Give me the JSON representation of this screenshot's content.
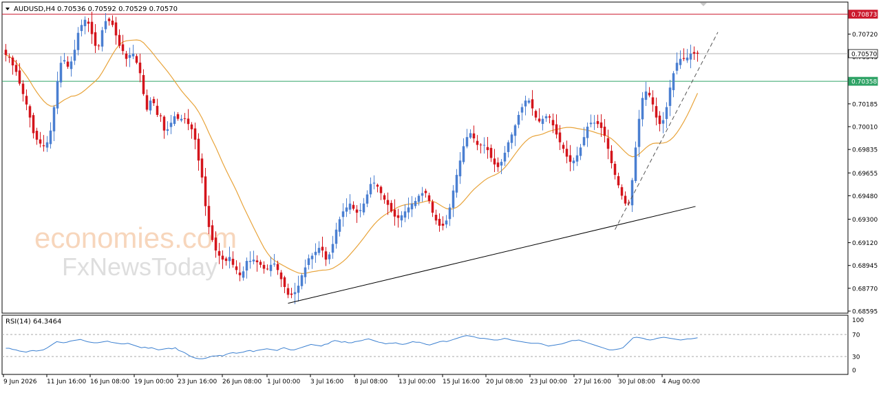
{
  "header": {
    "symbol_label": "AUDUSD,H4",
    "ohlc_label": "0.70536 0.70592 0.70529 0.70570"
  },
  "rsi_header": {
    "label": "RSI(14) 64.3464"
  },
  "watermark": {
    "line1": "economies.com",
    "line2": "FxNewsToday"
  },
  "colors": {
    "bull": "#4a7fd1",
    "bear": "#d4141b",
    "ma": "#e8a339",
    "rsi": "#3a7fd0",
    "resistance": "#cc1a2e",
    "support_level": "#2fa366",
    "current_line": "#b0b0b0",
    "trendline": "#000000",
    "grid": "#000000"
  },
  "chart_data": [
    {
      "type": "candlestick",
      "title": "AUDUSD,H4",
      "ylim": [
        0.68595,
        0.7095
      ],
      "y_ticks": [
        "0.70720",
        "0.70545",
        "0.70370",
        "0.70185",
        "0.70010",
        "0.69835",
        "0.69655",
        "0.69480",
        "0.69300",
        "0.69120",
        "0.68945",
        "0.68770",
        "0.68595"
      ],
      "x_tick_labels": [
        "9 Jun 2026",
        "11 Jun 16:00",
        "16 Jun 08:00",
        "19 Jun 00:00",
        "23 Jun 16:00",
        "26 Jun 08:00",
        "1 Jul 00:00",
        "3 Jul 16:00",
        "8 Jul 08:00",
        "13 Jul 00:00",
        "15 Jul 16:00",
        "20 Jul 08:00",
        "23 Jul 00:00",
        "27 Jul 16:00",
        "30 Jul 08:00",
        "4 Aug 00:00"
      ],
      "price_levels": [
        {
          "name": "resistance",
          "value": 0.70873,
          "label": "0.70873"
        },
        {
          "name": "current",
          "value": 0.7057,
          "label": "0.70570"
        },
        {
          "name": "support",
          "value": 0.70358,
          "label": "0.70358"
        }
      ],
      "closes": [
        0.7056,
        0.7054,
        0.7048,
        0.7043,
        0.7034,
        0.7026,
        0.7018,
        0.7008,
        0.6996,
        0.6991,
        0.6988,
        0.6986,
        0.6989,
        0.6998,
        0.7016,
        0.7036,
        0.705,
        0.7052,
        0.7047,
        0.7051,
        0.706,
        0.7073,
        0.7079,
        0.7083,
        0.708,
        0.7072,
        0.7063,
        0.7063,
        0.7075,
        0.7082,
        0.7082,
        0.7079,
        0.7071,
        0.7063,
        0.7059,
        0.7053,
        0.7056,
        0.7057,
        0.705,
        0.7042,
        0.7026,
        0.7014,
        0.7021,
        0.7019,
        0.701,
        0.7009,
        0.6998,
        0.6999,
        0.7004,
        0.7009,
        0.7007,
        0.7007,
        0.7007,
        0.7003,
        0.6999,
        0.6991,
        0.6975,
        0.6962,
        0.694,
        0.6924,
        0.6914,
        0.6906,
        0.6902,
        0.6899,
        0.6898,
        0.6901,
        0.6895,
        0.6891,
        0.6887,
        0.689,
        0.6898,
        0.6898,
        0.6899,
        0.6897,
        0.6895,
        0.6892,
        0.6892,
        0.6895,
        0.6896,
        0.6891,
        0.6884,
        0.6878,
        0.6872,
        0.6872,
        0.6874,
        0.6879,
        0.6887,
        0.6893,
        0.69,
        0.6902,
        0.6905,
        0.6908,
        0.6906,
        0.6899,
        0.6903,
        0.6911,
        0.6922,
        0.693,
        0.6936,
        0.6939,
        0.6942,
        0.6938,
        0.6935,
        0.6937,
        0.6942,
        0.6949,
        0.6957,
        0.6958,
        0.6955,
        0.695,
        0.6945,
        0.6941,
        0.6936,
        0.6932,
        0.6931,
        0.6933,
        0.6936,
        0.6939,
        0.6942,
        0.6944,
        0.6948,
        0.695,
        0.695,
        0.6944,
        0.6935,
        0.6929,
        0.6925,
        0.6925,
        0.6929,
        0.6939,
        0.6952,
        0.6964,
        0.6975,
        0.6986,
        0.6993,
        0.6996,
        0.6992,
        0.6987,
        0.6987,
        0.6987,
        0.6983,
        0.6977,
        0.6972,
        0.697,
        0.6974,
        0.6981,
        0.6989,
        0.6995,
        0.7002,
        0.701,
        0.7016,
        0.7021,
        0.7021,
        0.7015,
        0.7008,
        0.7005,
        0.7007,
        0.7009,
        0.7008,
        0.7002,
        0.6995,
        0.6989,
        0.6984,
        0.6978,
        0.6974,
        0.6975,
        0.6979,
        0.6985,
        0.6993,
        0.7001,
        0.7004,
        0.7004,
        0.7003,
        0.7,
        0.6994,
        0.6984,
        0.6973,
        0.6964,
        0.6956,
        0.6948,
        0.6942,
        0.6942,
        0.696,
        0.6985,
        0.7007,
        0.7023,
        0.7028,
        0.7025,
        0.7018,
        0.7008,
        0.7003,
        0.7006,
        0.7016,
        0.7031,
        0.7042,
        0.705,
        0.7053,
        0.7053,
        0.7054,
        0.7057,
        0.7057,
        0.7057
      ]
    },
    {
      "type": "line",
      "title": "RSI(14) 64.3464",
      "ylim": [
        0,
        100
      ],
      "y_ticks": [
        "100",
        "70",
        "30",
        "0"
      ],
      "levels": [
        70,
        30
      ],
      "values": [
        45,
        45,
        43,
        42,
        40,
        39,
        38,
        40,
        41,
        40,
        41,
        42,
        45,
        49,
        53,
        57,
        56,
        55,
        56,
        58,
        59,
        60,
        61,
        59,
        57,
        56,
        55,
        55,
        56,
        57,
        58,
        56,
        55,
        54,
        53,
        53,
        54,
        52,
        50,
        48,
        46,
        47,
        45,
        46,
        44,
        42,
        43,
        44,
        45,
        44,
        46,
        41,
        39,
        36,
        32,
        29,
        27,
        26,
        26,
        27,
        29,
        31,
        31,
        32,
        31,
        34,
        36,
        37,
        36,
        37,
        38,
        40,
        41,
        39,
        41,
        42,
        43,
        44,
        43,
        42,
        41,
        44,
        46,
        44,
        42,
        42,
        44,
        46,
        48,
        50,
        52,
        51,
        50,
        49,
        52,
        53,
        57,
        59,
        58,
        56,
        57,
        55,
        55,
        57,
        58,
        59,
        61,
        62,
        60,
        58,
        56,
        55,
        53,
        54,
        54,
        55,
        53,
        52,
        53,
        55,
        57,
        56,
        56,
        54,
        52,
        51,
        53,
        55,
        57,
        58,
        57,
        59,
        61,
        63,
        65,
        67,
        68,
        67,
        66,
        64,
        63,
        63,
        62,
        61,
        60,
        60,
        61,
        63,
        62,
        60,
        59,
        58,
        57,
        56,
        55,
        54,
        54,
        54,
        53,
        51,
        49,
        50,
        51,
        52,
        53,
        55,
        57,
        59,
        59,
        60,
        58,
        56,
        54,
        52,
        50,
        48,
        46,
        44,
        42,
        42,
        43,
        44,
        46,
        52,
        58,
        64,
        65,
        64,
        63,
        61,
        60,
        61,
        63,
        64,
        65,
        64,
        63,
        62,
        61,
        60,
        61,
        62,
        62,
        63,
        64
      ]
    }
  ]
}
